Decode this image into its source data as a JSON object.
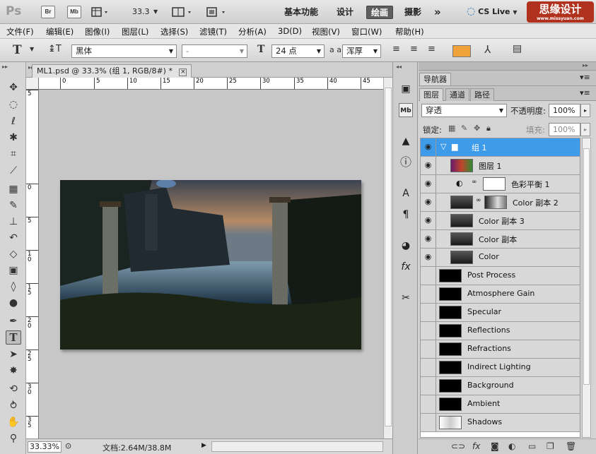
{
  "appbar": {
    "logo": "Ps",
    "bridge_label": "Br",
    "minibridge_label": "Mb",
    "zoom_value": "33.3",
    "workspaces": [
      "基本功能",
      "设计",
      "绘画",
      "摄影"
    ],
    "active_workspace": "绘画",
    "more_label": "»",
    "cslive_label": "CS Live",
    "watermark_text": "思缘设计",
    "watermark_url": "www.missyuan.com"
  },
  "menu": {
    "items": [
      "文件(F)",
      "编辑(E)",
      "图像(I)",
      "图层(L)",
      "选择(S)",
      "滤镜(T)",
      "分析(A)",
      "3D(D)",
      "视图(V)",
      "窗口(W)",
      "帮助(H)"
    ]
  },
  "options": {
    "font_family": "黑体",
    "font_style": "-",
    "font_size": "24 点",
    "aa_label": "a a",
    "aa_mode": "浑厚",
    "text_color": "#f0a23a"
  },
  "document": {
    "tab_title": "ML1.psd @ 33.3% (组 1, RGB/8#) *",
    "close_label": "×",
    "ruler_h_labels": [
      "0",
      "5",
      "10",
      "15",
      "20",
      "25",
      "30",
      "35",
      "40",
      "45"
    ],
    "ruler_v_labels": [
      "5",
      "0",
      "5",
      "1 0",
      "1 5",
      "2 0",
      "2 5",
      "3 0",
      "3 5"
    ]
  },
  "status": {
    "zoom": "33.33%",
    "doc_info": "文档:2.64M/38.8M"
  },
  "panels": {
    "navigator_tab": "导航器",
    "layers_tab": "图层",
    "channels_tab": "通道",
    "paths_tab": "路径",
    "blend_mode": "穿透",
    "opacity_label": "不透明度:",
    "opacity_value": "100%",
    "lock_label": "锁定:",
    "fill_label": "填充:",
    "fill_value": "100%"
  },
  "layers": [
    {
      "name": "组 1",
      "visible": true,
      "selected": true,
      "kind": "group"
    },
    {
      "name": "图层 1",
      "visible": true,
      "selected": false,
      "kind": "gradient"
    },
    {
      "name": "色彩平衡 1",
      "visible": true,
      "selected": false,
      "kind": "adjustment"
    },
    {
      "name": "Color 副本 2",
      "visible": true,
      "selected": false,
      "kind": "masked"
    },
    {
      "name": "Color 副本 3",
      "visible": true,
      "selected": false,
      "kind": "photo"
    },
    {
      "name": "Color 副本",
      "visible": true,
      "selected": false,
      "kind": "photo"
    },
    {
      "name": "Color",
      "visible": true,
      "selected": false,
      "kind": "photo"
    },
    {
      "name": "Post Process",
      "visible": false,
      "selected": false,
      "kind": "black"
    },
    {
      "name": "Atmosphere Gain",
      "visible": false,
      "selected": false,
      "kind": "black"
    },
    {
      "name": "Specular",
      "visible": false,
      "selected": false,
      "kind": "black"
    },
    {
      "name": "Reflections",
      "visible": false,
      "selected": false,
      "kind": "black"
    },
    {
      "name": "Refractions",
      "visible": false,
      "selected": false,
      "kind": "black"
    },
    {
      "name": "Indirect Lighting",
      "visible": false,
      "selected": false,
      "kind": "black"
    },
    {
      "name": "Background",
      "visible": false,
      "selected": false,
      "kind": "black"
    },
    {
      "name": "Ambient",
      "visible": false,
      "selected": false,
      "kind": "black"
    },
    {
      "name": "Shadows",
      "visible": false,
      "selected": false,
      "kind": "white"
    }
  ]
}
